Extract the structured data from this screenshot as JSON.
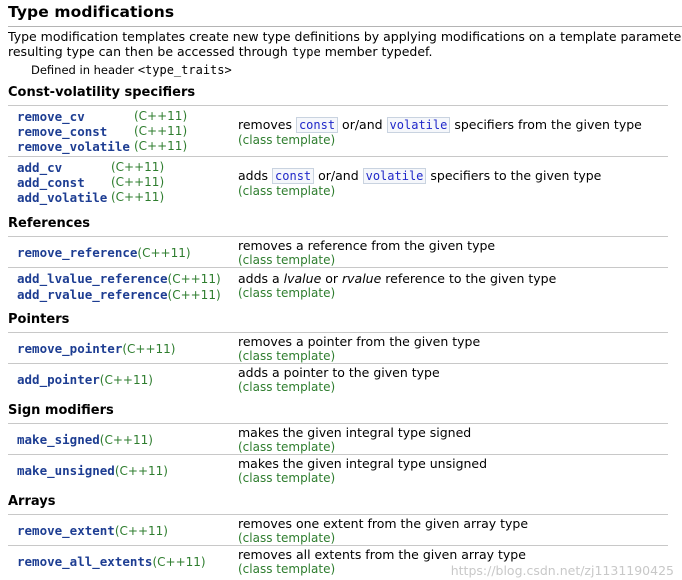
{
  "title": "Type modifications",
  "intro": {
    "line1": "Type modification templates create new type definitions by applying modifications on a template paramete",
    "line2_a": "resulting type can then be accessed through ",
    "line2_code": "type",
    "line2_b": " member typedef."
  },
  "defined_in": {
    "prefix": "Defined in header ",
    "header": "<type_traits>"
  },
  "version": "(C++11)",
  "class_template": "(class template)",
  "sections": {
    "cv": "Const-volatility specifiers",
    "ref": "References",
    "ptr": "Pointers",
    "sign": "Sign modifiers",
    "arr": "Arrays"
  },
  "rows": {
    "remove_cv": {
      "names": [
        "remove_cv",
        "remove_const",
        "remove_volatile"
      ],
      "desc_a": "removes ",
      "kw1": "const",
      "desc_b": " or/and ",
      "kw2": "volatile",
      "desc_c": " specifiers from the given type"
    },
    "add_cv": {
      "names": [
        "add_cv",
        "add_const",
        "add_volatile"
      ],
      "desc_a": "adds ",
      "kw1": "const",
      "desc_b": " or/and ",
      "kw2": "volatile",
      "desc_c": " specifiers to the given type"
    },
    "remove_reference": {
      "name": "remove_reference",
      "desc": "removes a reference from the given type"
    },
    "add_reference": {
      "names": [
        "add_lvalue_reference",
        "add_rvalue_reference"
      ],
      "desc_a": "adds a ",
      "em1": "lvalue",
      "desc_b": " or ",
      "em2": "rvalue",
      "desc_c": " reference to the given type"
    },
    "remove_pointer": {
      "name": "remove_pointer",
      "desc": "removes a pointer from the given type"
    },
    "add_pointer": {
      "name": "add_pointer",
      "desc": "adds a pointer to the given type"
    },
    "make_signed": {
      "name": "make_signed",
      "desc": "makes the given integral type signed"
    },
    "make_unsigned": {
      "name": "make_unsigned",
      "desc": "makes the given integral type unsigned"
    },
    "remove_extent": {
      "name": "remove_extent",
      "desc": "removes one extent from the given array type"
    },
    "remove_all_extents": {
      "name": "remove_all_extents",
      "desc": "removes all extents from the given array type"
    }
  },
  "watermark": "https://blog.csdn.net/zj1131190425"
}
